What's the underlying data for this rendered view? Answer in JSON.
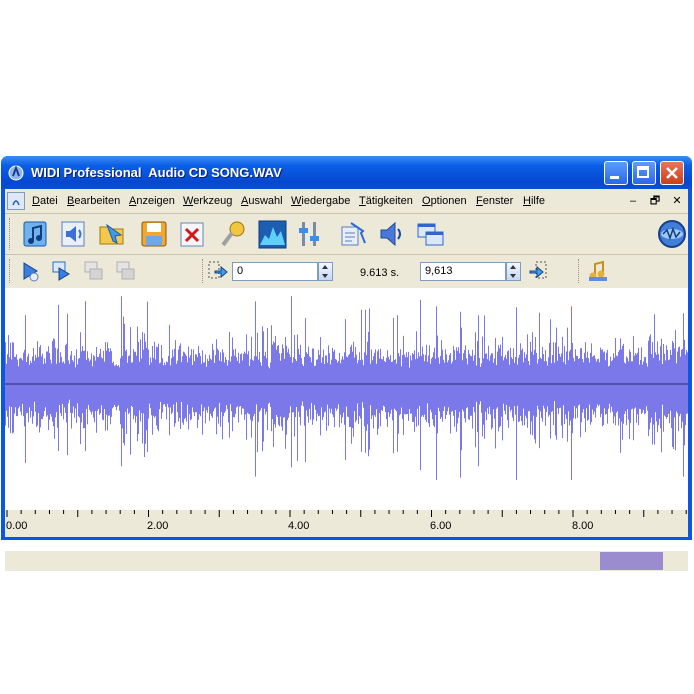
{
  "window": {
    "app_name": "WIDI Professional",
    "document": "Audio CD SONG.WAV"
  },
  "menu": [
    {
      "ul": "D",
      "rest": "atei"
    },
    {
      "ul": "B",
      "rest": "earbeiten"
    },
    {
      "ul": "A",
      "rest": "nzeigen"
    },
    {
      "ul": "W",
      "rest": "erkzeug"
    },
    {
      "ul": "A",
      "rest": "uswahl"
    },
    {
      "ul": "W",
      "rest": "iedergabe"
    },
    {
      "ul": "T",
      "rest": "ätigkeiten"
    },
    {
      "ul": "O",
      "rest": "ptionen"
    },
    {
      "ul": "F",
      "rest": "enster"
    },
    {
      "ul": "H",
      "rest": "ilfe"
    }
  ],
  "mdi_controls": [
    "–",
    "🗗",
    "✕"
  ],
  "toolbar1_icons": [
    "new-midi-icon",
    "open-audio-icon",
    "open-folder-icon",
    "save-icon",
    "delete-icon",
    "microphone-icon",
    "spectrum-icon",
    "equalizer-icon",
    "convert-icon",
    "volume-icon",
    "windows-icon",
    "widi-logo-icon"
  ],
  "toolbar2_icons": [
    "play-icon",
    "play-loop-icon",
    "play-selection-icon",
    "stop-icon"
  ],
  "selection": {
    "start": "0",
    "length": "9.613 s.",
    "end": "9,613"
  },
  "timeline": {
    "ticks": [
      "0.00",
      "2.00",
      "4.00",
      "6.00",
      "8.00"
    ],
    "max_seconds": 9.613
  },
  "colors": {
    "title_blue": "#0a58e0",
    "wave": "#7b78ea",
    "face": "#ece9d8"
  }
}
